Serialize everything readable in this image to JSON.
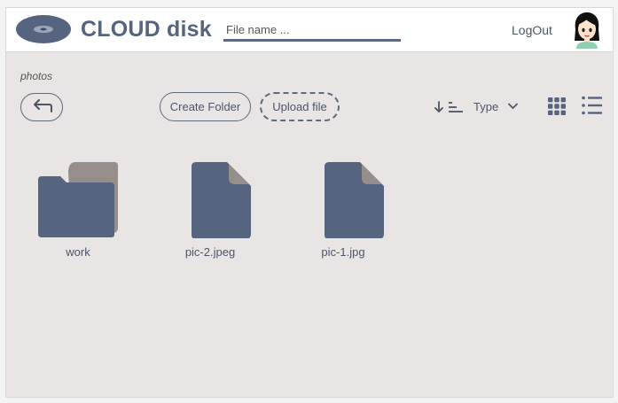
{
  "app": {
    "title": "CLOUD disk"
  },
  "header": {
    "search_placeholder": "File name ...",
    "logout_label": "LogOut"
  },
  "breadcrumb": {
    "current": "photos"
  },
  "toolbar": {
    "create_folder_label": "Create Folder",
    "upload_file_label": "Upload file",
    "sort_label": "Type"
  },
  "files": [
    {
      "name": "work",
      "kind": "folder",
      "icon": "folder-icon"
    },
    {
      "name": "pic-2.jpeg",
      "kind": "file",
      "icon": "file-icon"
    },
    {
      "name": "pic-1.jpg",
      "kind": "file",
      "icon": "file-icon"
    }
  ],
  "colors": {
    "accent": "#56647f",
    "background": "#e9e5e5",
    "header_bg": "#ffffff",
    "folder_back": "#958e8a"
  }
}
